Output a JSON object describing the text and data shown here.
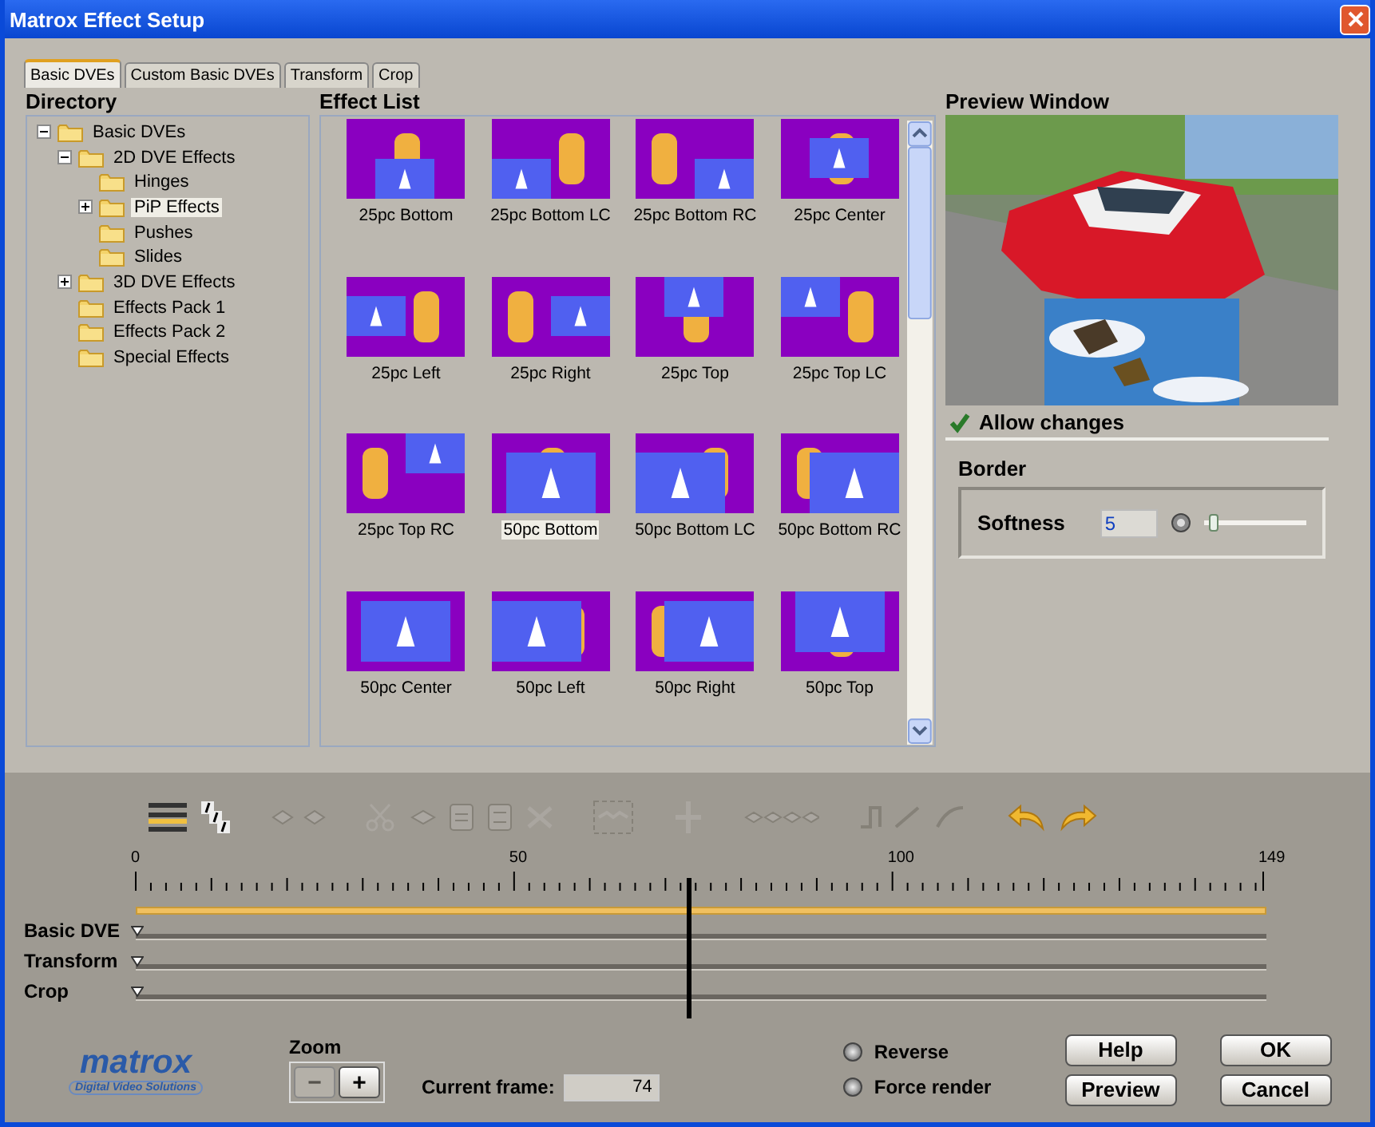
{
  "window": {
    "title": "Matrox Effect Setup"
  },
  "tabs": [
    {
      "label": "Basic DVEs",
      "selected": true
    },
    {
      "label": "Custom Basic DVEs",
      "selected": false
    },
    {
      "label": "Transform",
      "selected": false
    },
    {
      "label": "Crop",
      "selected": false
    }
  ],
  "directory": {
    "title": "Directory",
    "tree": [
      {
        "label": "Basic DVEs",
        "expanded": true,
        "selected": false,
        "children": [
          {
            "label": "2D DVE Effects",
            "expanded": true,
            "selected": false,
            "children": [
              {
                "label": "Hinges",
                "selected": false
              },
              {
                "label": "PiP Effects",
                "expanded": false,
                "selected": true
              },
              {
                "label": "Pushes",
                "selected": false
              },
              {
                "label": "Slides",
                "selected": false
              }
            ]
          },
          {
            "label": "3D DVE Effects",
            "expanded": false,
            "selected": false
          },
          {
            "label": "Effects Pack 1",
            "selected": false
          },
          {
            "label": "Effects Pack 2",
            "selected": false
          },
          {
            "label": "Special Effects",
            "selected": false
          }
        ]
      }
    ]
  },
  "effect_list": {
    "title": "Effect List",
    "items": [
      {
        "label": "25pc Bottom",
        "kind": "q-bottom",
        "selected": false
      },
      {
        "label": "25pc Bottom LC",
        "kind": "q-bottom-lc",
        "selected": false
      },
      {
        "label": "25pc Bottom RC",
        "kind": "q-bottom-rc",
        "selected": false
      },
      {
        "label": "25pc Center",
        "kind": "q-center",
        "selected": false
      },
      {
        "label": "25pc Left",
        "kind": "q-left",
        "selected": false
      },
      {
        "label": "25pc Right",
        "kind": "q-right",
        "selected": false
      },
      {
        "label": "25pc Top",
        "kind": "q-top",
        "selected": false
      },
      {
        "label": "25pc Top LC",
        "kind": "q-top-lc",
        "selected": false
      },
      {
        "label": "25pc Top RC",
        "kind": "q-top-rc",
        "selected": false
      },
      {
        "label": "50pc Bottom",
        "kind": "h-bottom",
        "selected": true
      },
      {
        "label": "50pc Bottom LC",
        "kind": "h-bottom-lc",
        "selected": false
      },
      {
        "label": "50pc Bottom RC",
        "kind": "h-bottom-rc",
        "selected": false
      },
      {
        "label": "50pc Center",
        "kind": "h-center",
        "selected": false
      },
      {
        "label": "50pc Left",
        "kind": "h-left",
        "selected": false
      },
      {
        "label": "50pc Right",
        "kind": "h-right",
        "selected": false
      },
      {
        "label": "50pc Top",
        "kind": "h-top",
        "selected": false
      }
    ]
  },
  "preview": {
    "title": "Preview Window",
    "kind": "picture",
    "allow_changes": {
      "label": "Allow changes",
      "checked": true
    }
  },
  "border": {
    "title": "Border",
    "softness": {
      "label": "Softness",
      "value": "5",
      "level": 0.05
    }
  },
  "timeline": {
    "ruler": [
      "0",
      "50",
      "100",
      "149"
    ],
    "playhead": {
      "level": 0.497
    },
    "tracks": [
      {
        "label": "Basic DVE"
      },
      {
        "label": "Transform"
      },
      {
        "label": "Crop"
      }
    ]
  },
  "footer": {
    "logo": "matrox",
    "logo_tagline": "Digital Video Solutions",
    "zoom_label": "Zoom",
    "zoom_out": "−",
    "zoom_in": "+",
    "current_frame_label": "Current frame:",
    "current_frame": "74",
    "options": [
      {
        "label": "Reverse",
        "checked": false
      },
      {
        "label": "Force render",
        "checked": false
      }
    ],
    "buttons": [
      "Help",
      "Preview",
      "OK",
      "Cancel"
    ]
  }
}
